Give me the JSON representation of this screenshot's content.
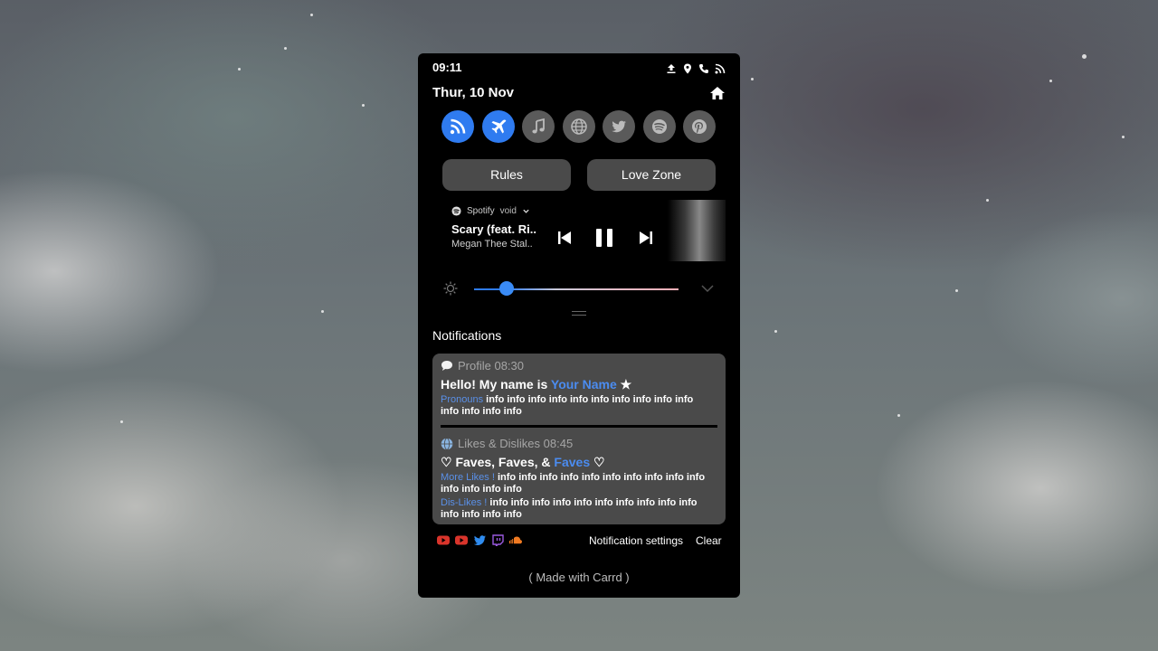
{
  "status": {
    "time": "09:11",
    "icons": [
      "upload-icon",
      "location-icon",
      "phone-icon",
      "rss-icon"
    ]
  },
  "header": {
    "date": "Thur, 10 Nov",
    "home_icon": "home-icon"
  },
  "quick_settings": [
    {
      "name": "rss-icon",
      "active": true
    },
    {
      "name": "airplane-icon",
      "active": true
    },
    {
      "name": "music-icon",
      "active": false
    },
    {
      "name": "globe-icon",
      "active": false
    },
    {
      "name": "twitter-icon",
      "active": false
    },
    {
      "name": "spotify-icon",
      "active": false
    },
    {
      "name": "pinterest-icon",
      "active": false
    }
  ],
  "buttons": {
    "left": "Rules",
    "right": "Love Zone"
  },
  "media": {
    "source": "Spotify",
    "device": "void",
    "track": "Scary (feat. Ri..",
    "artist": "Megan Thee Stal.."
  },
  "brightness": {
    "level": 0.16
  },
  "notifications_title": "Notifications",
  "notifications": [
    {
      "app": "Profile 08:30",
      "title_pre": "Hello! My name is ",
      "title_highlight": "Your Name",
      "label1": "Pronouns",
      "text1": " info info info info info info info info info info info info info info",
      "label2": "",
      "text2": ""
    },
    {
      "app": "Likes & Dislikes 08:45",
      "title_pre": "Faves, Faves, & ",
      "title_highlight": "Faves",
      "label1": "More Likes !",
      "text1": " info info info info info info info info info info info info info info",
      "label2": "Dis-Likes !",
      "text2": " info info info info info info info info info info info info info info"
    }
  ],
  "footer": {
    "settings": "Notification settings",
    "clear": "Clear",
    "made_with": "( Made with Carrd )",
    "social_icons": [
      "youtube-icon",
      "youtube-icon",
      "twitter-icon",
      "twitch-icon",
      "soundcloud-icon"
    ]
  },
  "colors": {
    "accent": "#2f7bf0",
    "panel": "#000000",
    "card": "#4a4a4a",
    "highlight": "#4b8cf0"
  }
}
